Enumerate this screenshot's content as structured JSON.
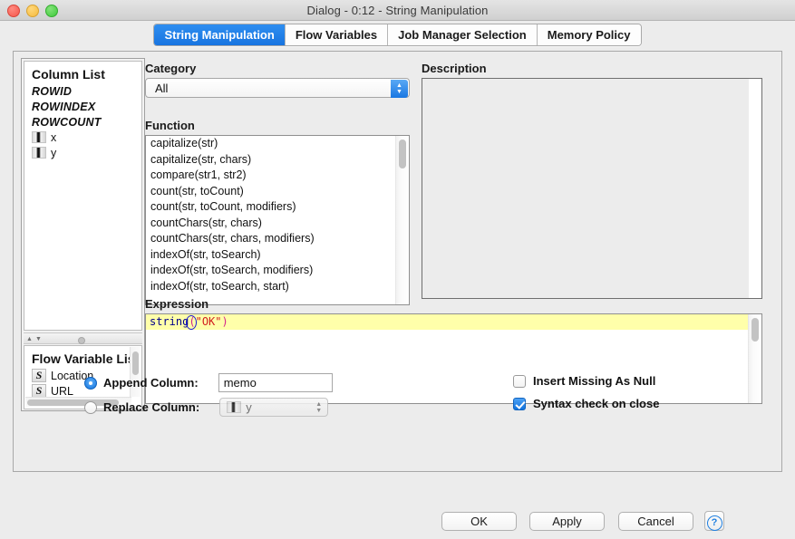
{
  "window": {
    "title": "Dialog - 0:12 - String Manipulation",
    "traffic_lights": [
      "close-button",
      "minimize-button",
      "zoom-button"
    ]
  },
  "tabs": [
    {
      "label": "String Manipulation",
      "active": true
    },
    {
      "label": "Flow Variables",
      "active": false
    },
    {
      "label": "Job Manager Selection",
      "active": false
    },
    {
      "label": "Memory Policy",
      "active": false
    }
  ],
  "column_list": {
    "title": "Column List",
    "items": [
      {
        "label": "ROWID",
        "icon": "",
        "italic": true
      },
      {
        "label": "ROWINDEX",
        "icon": "",
        "italic": true
      },
      {
        "label": "ROWCOUNT",
        "icon": "",
        "italic": true
      },
      {
        "label": "x",
        "icon": "column-type-icon",
        "italic": false
      },
      {
        "label": "y",
        "icon": "column-type-icon",
        "italic": false
      }
    ]
  },
  "flow_variable_list": {
    "title": "Flow Variable List",
    "items": [
      {
        "label": "Location",
        "icon": "string-variable-icon"
      },
      {
        "label": "URL",
        "icon": "string-variable-icon"
      }
    ]
  },
  "category": {
    "label": "Category",
    "selected": "All",
    "options": [
      "All"
    ]
  },
  "function": {
    "label": "Function",
    "items": [
      "capitalize(str)",
      "capitalize(str, chars)",
      "compare(str1, str2)",
      "count(str, toCount)",
      "count(str, toCount, modifiers)",
      "countChars(str, chars)",
      "countChars(str, chars, modifiers)",
      "indexOf(str, toSearch)",
      "indexOf(str, toSearch, modifiers)",
      "indexOf(str, toSearch, start)"
    ]
  },
  "description": {
    "label": "Description",
    "content": ""
  },
  "expression": {
    "label": "Expression",
    "value": "string(\"OK\")",
    "tokens": [
      {
        "text": "string",
        "type": "function"
      },
      {
        "text": "(",
        "type": "paren"
      },
      {
        "text": "\"OK\"",
        "type": "string"
      },
      {
        "text": ")",
        "type": "paren"
      }
    ]
  },
  "options": {
    "append_column": {
      "label": "Append Column:",
      "checked": true,
      "value": "memo"
    },
    "replace_column": {
      "label": "Replace Column:",
      "checked": false,
      "value": "y",
      "disabled": true
    },
    "insert_missing_as_null": {
      "label": "Insert Missing As Null",
      "checked": false
    },
    "syntax_check_on_close": {
      "label": "Syntax check on close",
      "checked": true
    }
  },
  "buttons": {
    "ok": "OK",
    "apply": "Apply",
    "cancel": "Cancel",
    "help": "?"
  },
  "colors": {
    "accent_blue": "#1874e0",
    "expression_highlight": "#ffffaa",
    "token_function": "#00008b",
    "token_paren": "#d4258c",
    "token_string": "#d12020",
    "window_background": "#ececec"
  }
}
